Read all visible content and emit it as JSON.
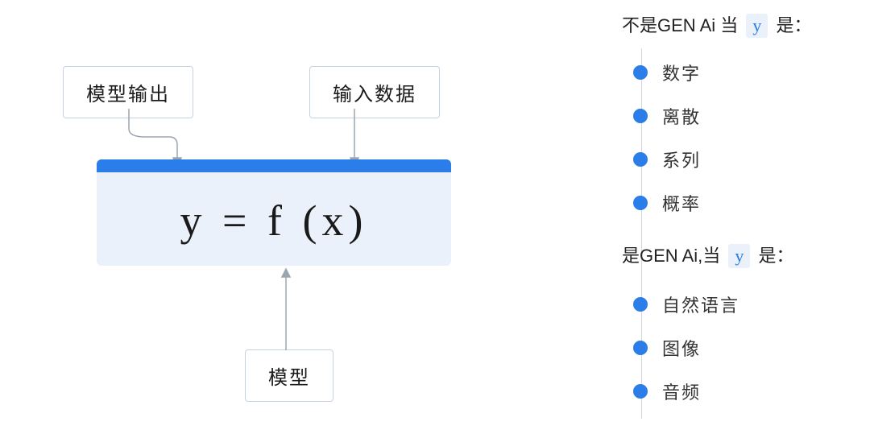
{
  "diagram": {
    "label_output": "模型输出",
    "label_input": "输入数据",
    "label_model": "模型",
    "formula": "y = f (x)"
  },
  "sections": {
    "not_gen": {
      "prefix": "不是GEN Ai 当",
      "chip": "y",
      "suffix": "是：",
      "items": [
        "数字",
        "离散",
        "系列",
        "概率"
      ]
    },
    "is_gen": {
      "prefix": "是GEN Ai,当",
      "chip": "y",
      "suffix": "是：",
      "items": [
        "自然语言",
        "图像",
        "音频"
      ]
    }
  }
}
